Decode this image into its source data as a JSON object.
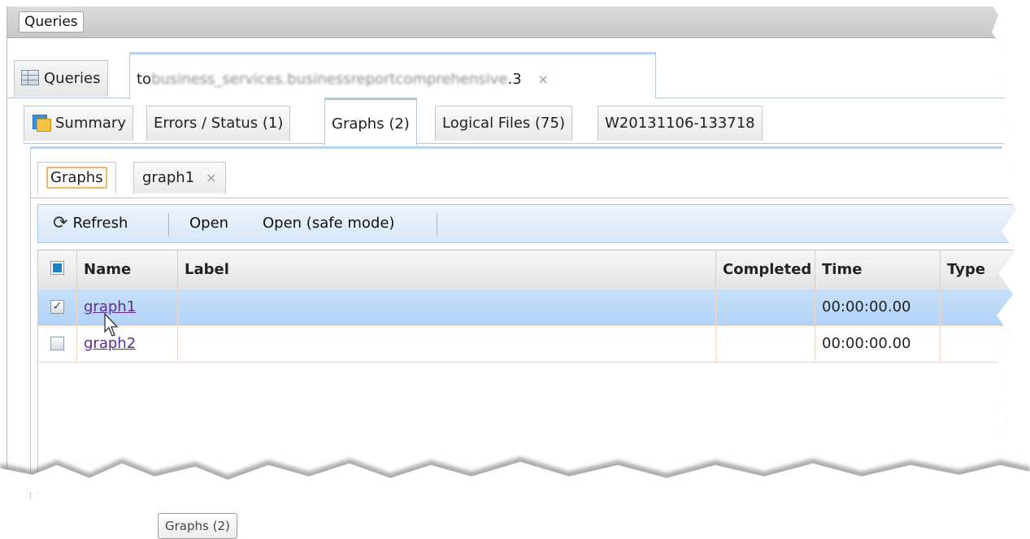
{
  "topbar": {
    "button_label": "Queries"
  },
  "main_tabs": {
    "queries_label": "Queries",
    "query_tab_prefix": "to",
    "query_tab_blurred": "business_services.businessreportcomprehensive",
    "query_tab_suffix": ".3",
    "close_glyph": "×"
  },
  "wu_tabs": [
    {
      "label": "Summary",
      "icon": "summary-icon"
    },
    {
      "label": "Errors / Status (1)"
    },
    {
      "label": "Graphs (2)"
    },
    {
      "label": "Logical Files (75)"
    },
    {
      "label": "W20131106-133718"
    }
  ],
  "graph_tabs": {
    "graphs_label": "Graphs",
    "graph1_label": "graph1",
    "close_glyph": "×"
  },
  "toolbar": {
    "refresh_label": "Refresh",
    "open_label": "Open",
    "open_safe_label": "Open (safe mode)"
  },
  "table": {
    "columns": [
      "Name",
      "Label",
      "Completed",
      "Time",
      "Type"
    ],
    "rows": [
      {
        "name": "graph1",
        "label": "",
        "completed": "",
        "time": "00:00:00.00",
        "type": "",
        "checked": true,
        "selected": true
      },
      {
        "name": "graph2",
        "label": "",
        "completed": "",
        "time": "00:00:00.00",
        "type": "",
        "checked": false,
        "selected": false
      }
    ]
  },
  "tooltip": {
    "text": "Graphs (2)"
  },
  "colors": {
    "selected_row": "#b9d7f7",
    "toolbar": "#dce9f8",
    "link": "#5b2c91",
    "active_tab_border": "#f0b46a"
  }
}
